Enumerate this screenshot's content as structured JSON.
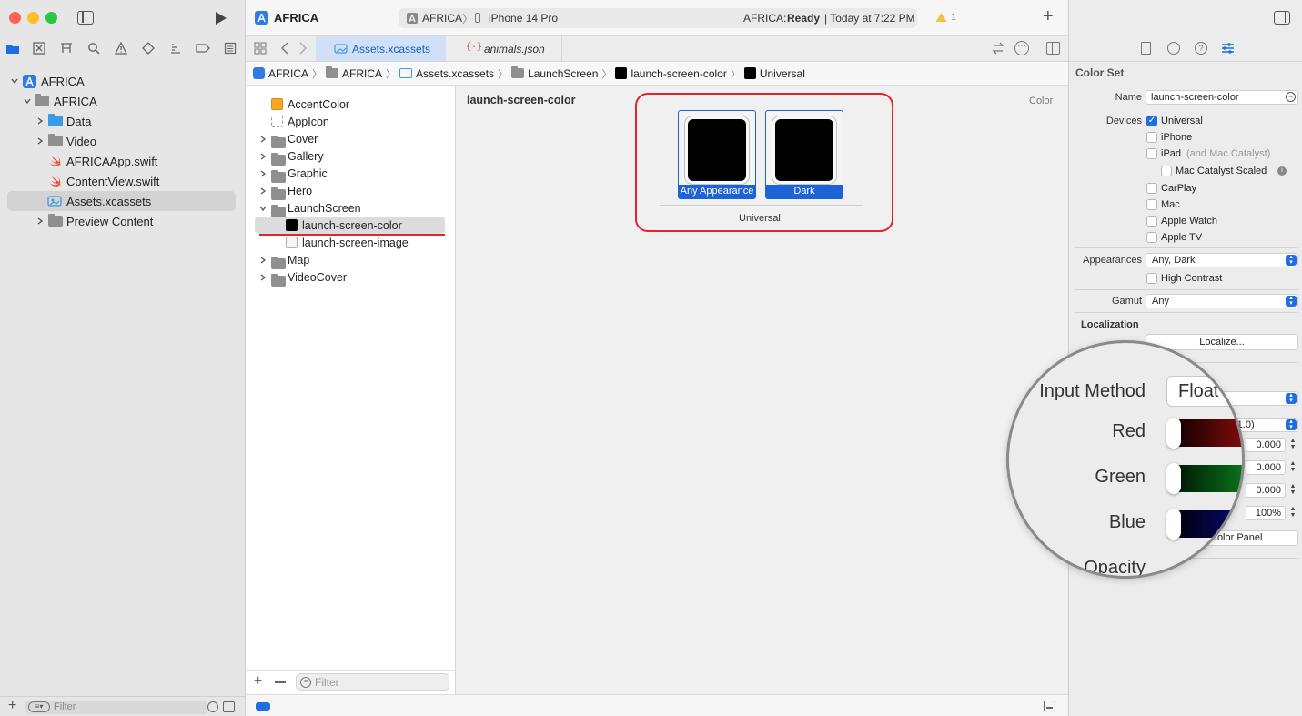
{
  "navigator": {
    "project": "AFRICA",
    "group": "AFRICA",
    "items": [
      {
        "label": "Data",
        "kind": "folder"
      },
      {
        "label": "Video",
        "kind": "folder"
      },
      {
        "label": "AFRICAApp.swift",
        "kind": "swift"
      },
      {
        "label": "ContentView.swift",
        "kind": "swift"
      },
      {
        "label": "Assets.xcassets",
        "kind": "assets",
        "selected": true
      },
      {
        "label": "Preview Content",
        "kind": "folder"
      }
    ],
    "filter_placeholder": "Filter"
  },
  "toolbar": {
    "title": "AFRICA",
    "scheme": "AFRICA",
    "destination": "iPhone 14 Pro",
    "status_prefix": "AFRICA:",
    "status_state": "Ready",
    "status_time": "| Today at 7:22 PM",
    "warning_count": "1"
  },
  "tabs": [
    {
      "label": "Assets.xcassets",
      "active": true
    },
    {
      "label": "animals.json",
      "active": false
    }
  ],
  "jumpbar": [
    "AFRICA",
    "AFRICA",
    "Assets.xcassets",
    "LaunchScreen",
    "launch-screen-color",
    "Universal"
  ],
  "assets": {
    "items": [
      {
        "label": "AccentColor",
        "kind": "color"
      },
      {
        "label": "AppIcon",
        "kind": "appicon"
      },
      {
        "label": "Cover",
        "kind": "folder"
      },
      {
        "label": "Gallery",
        "kind": "folder"
      },
      {
        "label": "Graphic",
        "kind": "folder"
      },
      {
        "label": "Hero",
        "kind": "folder"
      },
      {
        "label": "LaunchScreen",
        "kind": "folder-open"
      },
      {
        "label": "launch-screen-color",
        "kind": "color-child",
        "selected": true
      },
      {
        "label": "launch-screen-image",
        "kind": "image-child"
      },
      {
        "label": "Map",
        "kind": "folder"
      },
      {
        "label": "VideoCover",
        "kind": "folder"
      }
    ],
    "filter_placeholder": "Filter"
  },
  "editor": {
    "asset_name": "launch-screen-color",
    "type_label": "Color",
    "swatches": [
      "Any Appearance",
      "Dark"
    ],
    "group_label": "Universal"
  },
  "inspector": {
    "section_title": "Color Set",
    "name_label": "Name",
    "name_value": "launch-screen-color",
    "devices_label": "Devices",
    "devices": [
      {
        "label": "Universal",
        "checked": true
      },
      {
        "label": "iPhone",
        "checked": false
      },
      {
        "label": "iPad",
        "suffix": "(and Mac Catalyst)",
        "checked": false
      },
      {
        "label": "Mac Catalyst Scaled",
        "checked": false
      },
      {
        "label": "CarPlay",
        "checked": false
      },
      {
        "label": "Mac",
        "checked": false
      },
      {
        "label": "Apple Watch",
        "checked": false
      },
      {
        "label": "Apple TV",
        "checked": false
      }
    ],
    "appearances_label": "Appearances",
    "appearances_value": "Any, Dark",
    "high_contrast_label": "High Contrast",
    "gamut_label": "Gamut",
    "gamut_value": "Any",
    "localization_title": "Localization",
    "localize_button": "Localize...",
    "range_partial": "-1.0)",
    "red_value": "0.000",
    "green_value": "0.000",
    "blue_value": "0.000",
    "opacity_value": "100%",
    "color_panel_partial": "Color Panel"
  },
  "magnifier": {
    "input_method_label": "Input Method",
    "input_method_value": "Float",
    "red_label": "Red",
    "green_label": "Green",
    "blue_label": "Blue",
    "opacity_label": "Opacity"
  },
  "colors": {
    "accent": "#1d6de5",
    "highlight_ring": "#e0262b",
    "swift_orange": "#f05138",
    "folder_gray": "#8f8f8f",
    "folder_blue": "#3b9ae6"
  }
}
